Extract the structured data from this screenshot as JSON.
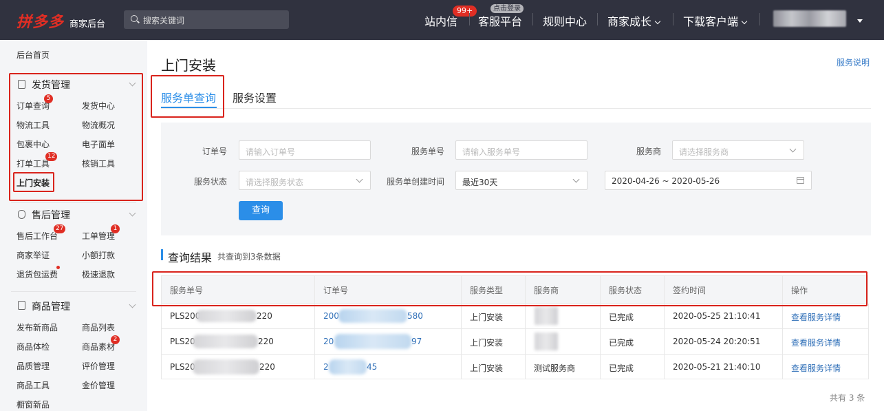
{
  "header": {
    "logo": "拼多多",
    "logo_sub": "商家后台",
    "search_placeholder": "搜索关键词",
    "nav": {
      "inbox": "站内信",
      "inbox_badge": "99+",
      "service": "客服平台",
      "service_tip": "点击登录",
      "rules": "规则中心",
      "growth": "商家成长",
      "download": "下载客户端"
    }
  },
  "sidebar": {
    "home": "后台首页",
    "groups": [
      {
        "title": "发货管理",
        "items": [
          {
            "label": "订单查询",
            "badge": "5"
          },
          {
            "label": "发货中心"
          },
          {
            "label": "物流工具"
          },
          {
            "label": "物流概况"
          },
          {
            "label": "包裹中心"
          },
          {
            "label": "电子面单"
          },
          {
            "label": "打单工具",
            "badge": "12"
          },
          {
            "label": "核销工具"
          },
          {
            "label": "上门安装"
          }
        ]
      },
      {
        "title": "售后管理",
        "items": [
          {
            "label": "售后工作台",
            "badge": "27"
          },
          {
            "label": "工单管理",
            "badge": "1"
          },
          {
            "label": "商家举证"
          },
          {
            "label": "小额打款"
          },
          {
            "label": "退货包运费"
          },
          {
            "label": "极速退款"
          }
        ]
      },
      {
        "title": "商品管理",
        "items": [
          {
            "label": "发布新商品"
          },
          {
            "label": "商品列表"
          },
          {
            "label": "商品体检"
          },
          {
            "label": "商品素材",
            "badge": "2"
          },
          {
            "label": "品质管理"
          },
          {
            "label": "评价管理"
          },
          {
            "label": "商品工具"
          },
          {
            "label": "金价管理"
          },
          {
            "label": "橱窗新品"
          }
        ]
      }
    ]
  },
  "main": {
    "title": "上门安装",
    "help_link": "服务说明",
    "tabs": [
      "服务单查询",
      "服务设置"
    ],
    "filters": {
      "order_no_label": "订单号",
      "order_no_placeholder": "请输入订单号",
      "service_no_label": "服务单号",
      "service_no_placeholder": "请输入服务单号",
      "provider_label": "服务商",
      "provider_placeholder": "请选择服务商",
      "status_label": "服务状态",
      "status_placeholder": "请选择服务状态",
      "created_label": "服务单创建时间",
      "created_value": "最近30天",
      "date_range": "2020-04-26 ~ 2020-05-26",
      "query_button": "查询"
    },
    "results": {
      "title": "查询结果",
      "count_text": "共查询到3条数据",
      "columns": [
        "服务单号",
        "订单号",
        "服务类型",
        "服务商",
        "服务状态",
        "签约时间",
        "操作"
      ],
      "rows": [
        {
          "service_prefix": "PLS200",
          "service_suffix": "220",
          "order_prefix": "200",
          "order_suffix": "580",
          "type": "上门安装",
          "provider": "",
          "status": "已完成",
          "time": "2020-05-25 21:10:41",
          "action": "查看服务详情"
        },
        {
          "service_prefix": "PLS20",
          "service_suffix": "220",
          "order_prefix": "20",
          "order_suffix": "97",
          "type": "上门安装",
          "provider": "",
          "status": "已完成",
          "time": "2020-05-24 20:20:51",
          "action": "查看服务详情"
        },
        {
          "service_prefix": "PLS20",
          "service_suffix": "220",
          "order_prefix": "2",
          "order_suffix": "45",
          "type": "上门安装",
          "provider": "测试服务商",
          "status": "已完成",
          "time": "2020-05-21 21:40:10",
          "action": "查看服务详情"
        }
      ],
      "total": "共有 3 条"
    }
  },
  "colors": {
    "brand": "#e02e24",
    "accent": "#2b8ee8",
    "topbar": "#30323f",
    "highlight_box": "#d9231c"
  }
}
